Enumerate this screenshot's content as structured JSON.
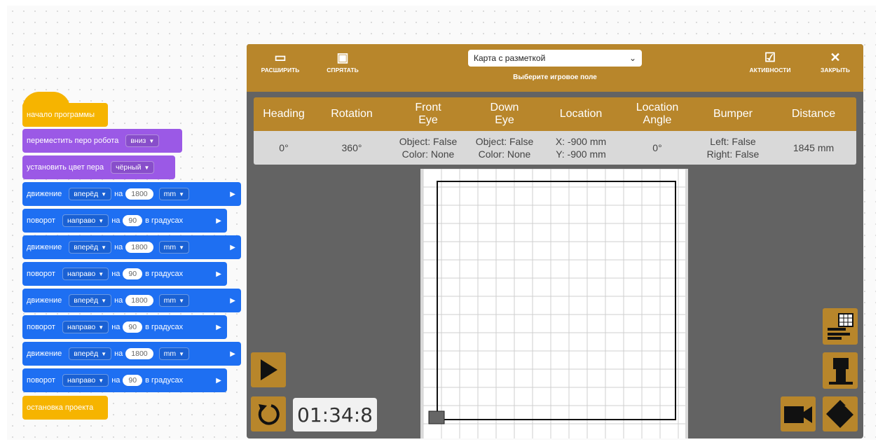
{
  "blocks": {
    "start": "начало программы",
    "pen": {
      "text": "переместить перо робота",
      "value": "вниз"
    },
    "color": {
      "text": "установить цвет пера",
      "value": "чёрный"
    },
    "move": {
      "text": "движение",
      "dir": "вперёд",
      "na": "на",
      "value": "1800",
      "unit": "mm"
    },
    "turn": {
      "text": "поворот",
      "dir": "направо",
      "na": "на",
      "value": "90",
      "suffix": "в градусах"
    },
    "stop": "остановка проекта"
  },
  "toolbar": {
    "expand": "РАСШИРИТЬ",
    "hide": "СПРЯТАТЬ",
    "field_value": "Карта с разметкой",
    "field_hint": "Выберите игровое поле",
    "activities": "АКТИВНОСТИ",
    "close": "ЗАКРЫТЬ"
  },
  "sensors": {
    "headers": [
      "Heading",
      "Rotation",
      "Front\nEye",
      "Down\nEye",
      "Location",
      "Location\nAngle",
      "Bumper",
      "Distance"
    ],
    "values": [
      "0°",
      "360°",
      "Object: False\nColor: None",
      "Object: False\nColor: None",
      "X: -900 mm\nY: -900 mm",
      "0°",
      "Left: False\nRight: False",
      "1845 mm"
    ]
  },
  "timer": "01:34:8",
  "colors": {
    "panel": "#636363",
    "accent": "#b8862b",
    "event": "#f6b400",
    "pen": "#9b59e6",
    "motion": "#1e6ff2"
  },
  "icons": [
    "expand-icon",
    "hide-icon",
    "chevron-down-icon",
    "activities-icon",
    "close-icon",
    "play-icon",
    "reset-icon",
    "table-icon",
    "robot-icon",
    "camera-icon",
    "move-icon"
  ]
}
